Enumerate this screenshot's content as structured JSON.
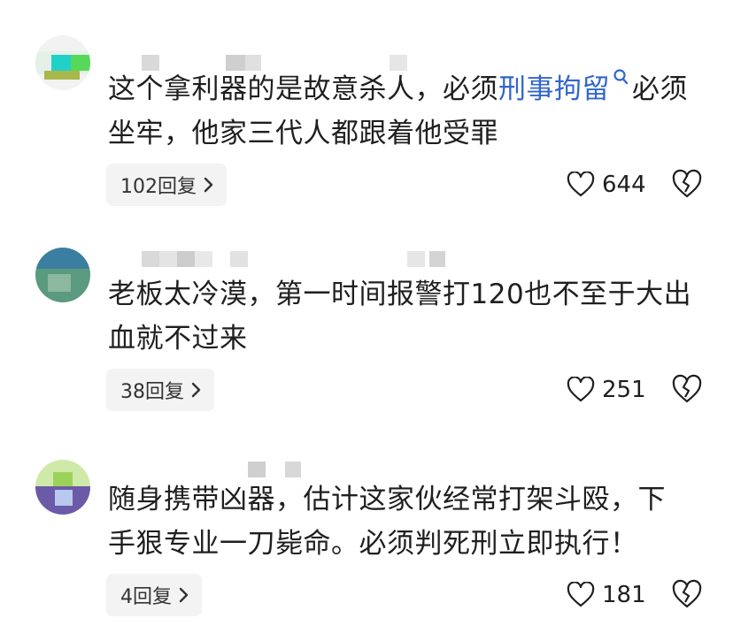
{
  "comments": [
    {
      "text_before_link": "这个拿利器的是故意杀人，必须",
      "link_text": "刑事拘留",
      "text_after_link": "必须坐牢，他家三代人都跟着他受罪",
      "reply_label": "102回复",
      "like_count": "644"
    },
    {
      "text": "老板太冷漠，第一时间报警打120也不至于大出血就不过来",
      "reply_label": "38回复",
      "like_count": "251"
    },
    {
      "text": "随身携带凶器，估计这家伙经常打架斗殴，下手狠专业一刀毙命。必须判死刑立即执行！",
      "reply_label": "4回复",
      "like_count": "181"
    }
  ],
  "icons": {
    "search": "search-icon",
    "chevron": "chevron-right-icon",
    "like": "heart-icon",
    "dislike": "broken-heart-icon"
  },
  "colors": {
    "link": "#3366cc",
    "reply_bg": "#f3f3f3",
    "text": "#1f1f1f"
  }
}
